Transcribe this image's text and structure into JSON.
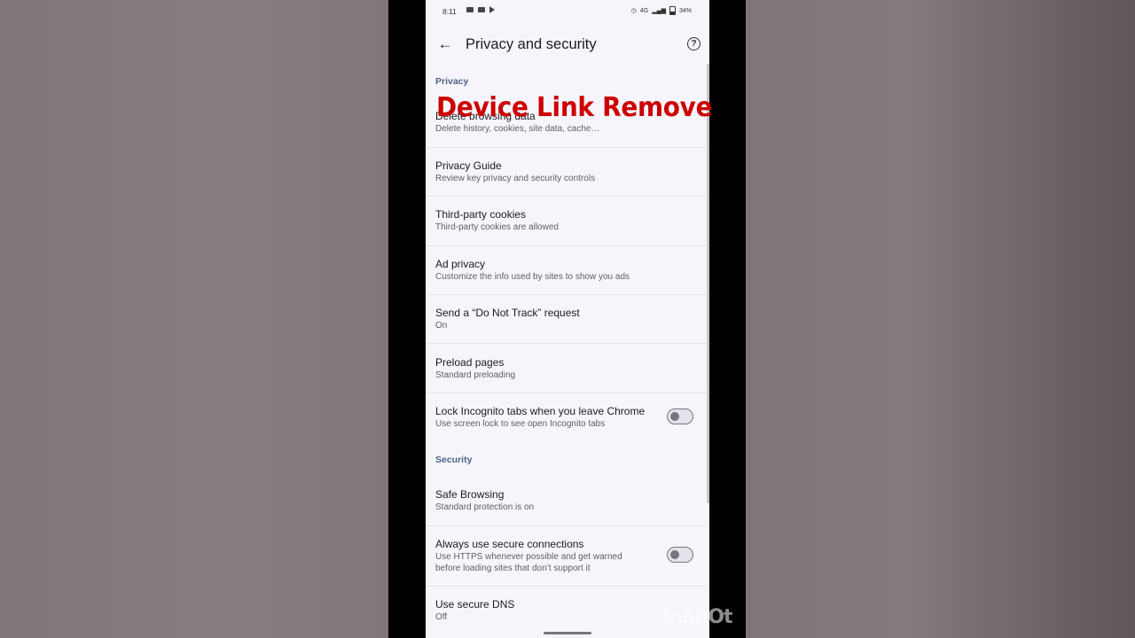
{
  "status_bar": {
    "time": "8:11",
    "network_label": "4G",
    "battery": "34%"
  },
  "header": {
    "title": "Privacy and security"
  },
  "overlay": {
    "headline": "Device Link Remove",
    "watermark": "InShOt"
  },
  "privacy": {
    "label": "Privacy",
    "items": [
      {
        "title": "Delete browsing data",
        "subtitle": "Delete history, cookies, site data, cache…"
      },
      {
        "title": "Privacy Guide",
        "subtitle": "Review key privacy and security controls"
      },
      {
        "title": "Third-party cookies",
        "subtitle": "Third-party cookies are allowed"
      },
      {
        "title": "Ad privacy",
        "subtitle": "Customize the info used by sites to show you ads"
      },
      {
        "title": "Send a “Do Not Track” request",
        "subtitle": "On"
      },
      {
        "title": "Preload pages",
        "subtitle": "Standard preloading"
      },
      {
        "title": "Lock Incognito tabs when you leave Chrome",
        "subtitle": "Use screen lock to see open Incognito tabs",
        "toggle": "off"
      }
    ]
  },
  "security": {
    "label": "Security",
    "items": [
      {
        "title": "Safe Browsing",
        "subtitle": "Standard protection is on"
      },
      {
        "title": "Always use secure connections",
        "subtitle": "Use HTTPS whenever possible and get warned before loading sites that don’t support it",
        "toggle": "off"
      },
      {
        "title": "Use secure DNS",
        "subtitle": "Off"
      }
    ]
  },
  "colors": {
    "accent": "#4e6287",
    "overlay_red": "#cc0000",
    "background": "#f6f5fb"
  }
}
